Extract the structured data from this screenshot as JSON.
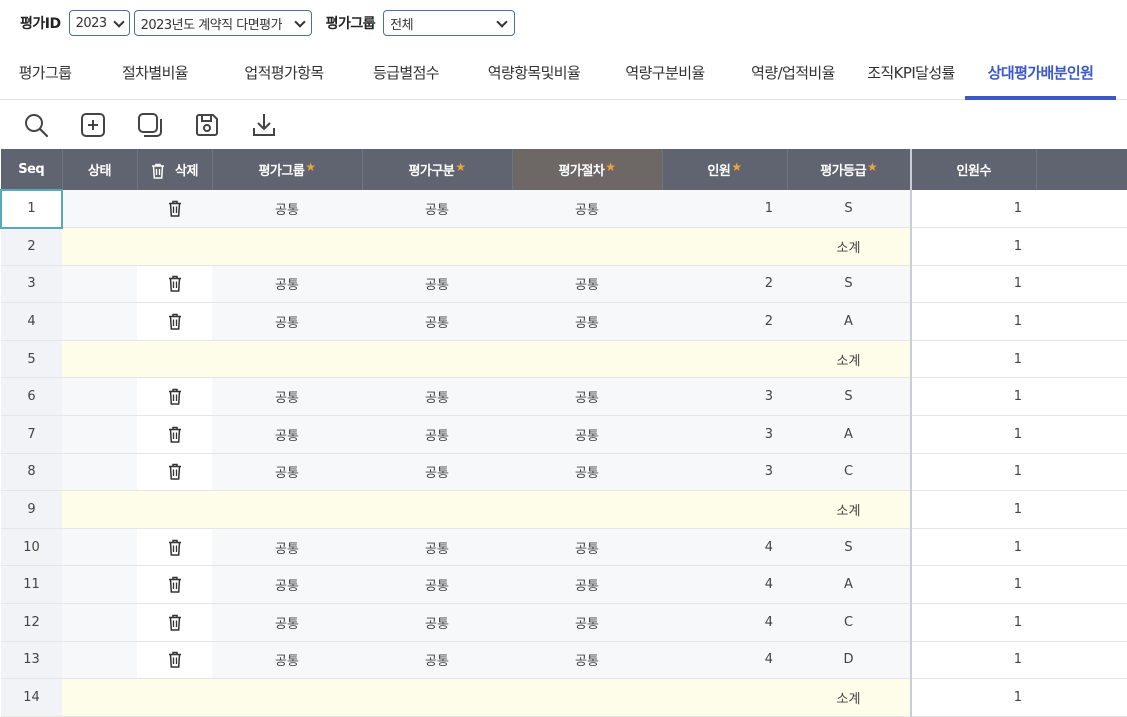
{
  "filters": {
    "eval_id_label": "평가ID",
    "year": "2023",
    "eval_name": "2023년도 계약직 다면평가",
    "eval_group_label": "평가그룹",
    "eval_group_value": "전체"
  },
  "tabs": [
    {
      "label": "평가그룹"
    },
    {
      "label": "절차별비율"
    },
    {
      "label": "업적평가항목"
    },
    {
      "label": "등급별점수"
    },
    {
      "label": "역량항목및비율"
    },
    {
      "label": "역량구분비율"
    },
    {
      "label": "역량/업적비율"
    },
    {
      "label": "조직KPI달성률"
    },
    {
      "label": "상대평가배분인원",
      "active": true
    }
  ],
  "toolbar": [
    "search-icon",
    "add-icon",
    "copy-icon",
    "save-icon",
    "download-icon"
  ],
  "columns": {
    "seq": "Seq",
    "status": "상태",
    "delete": "삭제",
    "group": "평가그룹",
    "division": "평가구분",
    "procedure": "평가절차",
    "headcount": "인원",
    "grade": "평가등급",
    "count": "인원수"
  },
  "rows": [
    {
      "seq": "1",
      "type": "data",
      "group": "공통",
      "division": "공통",
      "procedure": "공통",
      "headcount": "1",
      "grade": "S",
      "count": "1"
    },
    {
      "seq": "2",
      "type": "subtotal",
      "grade": "소계",
      "count": "1"
    },
    {
      "seq": "3",
      "type": "data",
      "group": "공통",
      "division": "공통",
      "procedure": "공통",
      "headcount": "2",
      "grade": "S",
      "count": "1"
    },
    {
      "seq": "4",
      "type": "data",
      "group": "공통",
      "division": "공통",
      "procedure": "공통",
      "headcount": "2",
      "grade": "A",
      "count": "1"
    },
    {
      "seq": "5",
      "type": "subtotal",
      "grade": "소계",
      "count": "1"
    },
    {
      "seq": "6",
      "type": "data",
      "group": "공통",
      "division": "공통",
      "procedure": "공통",
      "headcount": "3",
      "grade": "S",
      "count": "1"
    },
    {
      "seq": "7",
      "type": "data",
      "group": "공통",
      "division": "공통",
      "procedure": "공통",
      "headcount": "3",
      "grade": "A",
      "count": "1"
    },
    {
      "seq": "8",
      "type": "data",
      "group": "공통",
      "division": "공통",
      "procedure": "공통",
      "headcount": "3",
      "grade": "C",
      "count": "1"
    },
    {
      "seq": "9",
      "type": "subtotal",
      "grade": "소계",
      "count": "1"
    },
    {
      "seq": "10",
      "type": "data",
      "group": "공통",
      "division": "공통",
      "procedure": "공통",
      "headcount": "4",
      "grade": "S",
      "count": "1"
    },
    {
      "seq": "11",
      "type": "data",
      "group": "공통",
      "division": "공통",
      "procedure": "공통",
      "headcount": "4",
      "grade": "A",
      "count": "1"
    },
    {
      "seq": "12",
      "type": "data",
      "group": "공통",
      "division": "공통",
      "procedure": "공통",
      "headcount": "4",
      "grade": "C",
      "count": "1"
    },
    {
      "seq": "13",
      "type": "data",
      "group": "공통",
      "division": "공통",
      "procedure": "공통",
      "headcount": "4",
      "grade": "D",
      "count": "1"
    },
    {
      "seq": "14",
      "type": "subtotal",
      "grade": "소계",
      "count": "1"
    }
  ],
  "colors": {
    "accent": "#3b58c9",
    "header_bg": "#5f6470",
    "subtotal_bg": "#fefde9",
    "required_star": "#f0a23a"
  }
}
